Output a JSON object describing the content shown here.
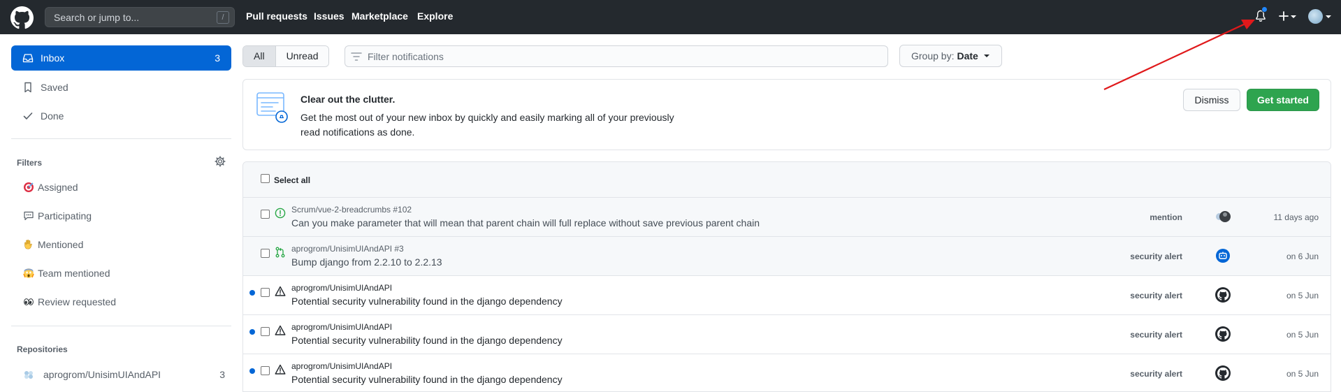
{
  "header": {
    "search_placeholder": "Search or jump to...",
    "search_key": "/",
    "nav": [
      "Pull requests",
      "Issues",
      "Marketplace",
      "Explore"
    ]
  },
  "sidebar": {
    "items": [
      {
        "label": "Inbox",
        "count": "3",
        "icon": "inbox-icon",
        "active": true
      },
      {
        "label": "Saved",
        "icon": "bookmark-icon"
      },
      {
        "label": "Done",
        "icon": "check-icon"
      }
    ],
    "filters_heading": "Filters",
    "filters": [
      {
        "label": "Assigned",
        "icon": "dart-emoji"
      },
      {
        "label": "Participating",
        "icon": "speech-balloon-emoji"
      },
      {
        "label": "Mentioned",
        "icon": "raised-hand-emoji"
      },
      {
        "label": "Team mentioned",
        "icon": "screaming-face-emoji"
      },
      {
        "label": "Review requested",
        "icon": "eyes-emoji"
      }
    ],
    "repos_heading": "Repositories",
    "repos": [
      {
        "name": "aprogrom/UnisimUIAndAPI",
        "count": "3"
      }
    ]
  },
  "toolbar": {
    "tabs": [
      "All",
      "Unread"
    ],
    "filter_placeholder": "Filter notifications",
    "group_by_label": "Group by:",
    "group_by_value": "Date"
  },
  "banner": {
    "title": "Clear out the clutter.",
    "text": "Get the most out of your new inbox by quickly and easily marking all of your previously read notifications as done.",
    "dismiss": "Dismiss",
    "get_started": "Get started"
  },
  "list": {
    "select_all": "Select all",
    "rows": [
      {
        "repo": "Scrum/vue-2-breadcrumbs #102",
        "title": "Can you make parameter that will mean that parent chain will full replace without save previous parent chain",
        "reason": "mention",
        "when": "11 days ago",
        "type": "issue-open-icon",
        "unread": false
      },
      {
        "repo": "aprogrom/UnisimUIAndAPI #3",
        "title": "Bump django from 2.2.10 to 2.2.13",
        "reason": "security alert",
        "when": "on 6 Jun",
        "type": "pull-request-icon",
        "unread": false
      },
      {
        "repo": "aprogrom/UnisimUIAndAPI",
        "title": "Potential security vulnerability found in the django dependency",
        "reason": "security alert",
        "when": "on 5 Jun",
        "type": "alert-icon",
        "unread": true
      },
      {
        "repo": "aprogrom/UnisimUIAndAPI",
        "title": "Potential security vulnerability found in the django dependency",
        "reason": "security alert",
        "when": "on 5 Jun",
        "type": "alert-icon",
        "unread": true
      },
      {
        "repo": "aprogrom/UnisimUIAndAPI",
        "title": "Potential security vulnerability found in the django dependency",
        "reason": "security alert",
        "when": "on 5 Jun",
        "type": "alert-icon",
        "unread": true
      }
    ]
  },
  "colors": {
    "header_bg": "#24292e",
    "accent": "#0366d6",
    "success": "#2ea44f",
    "annotation_arrow": "#e0191b"
  }
}
